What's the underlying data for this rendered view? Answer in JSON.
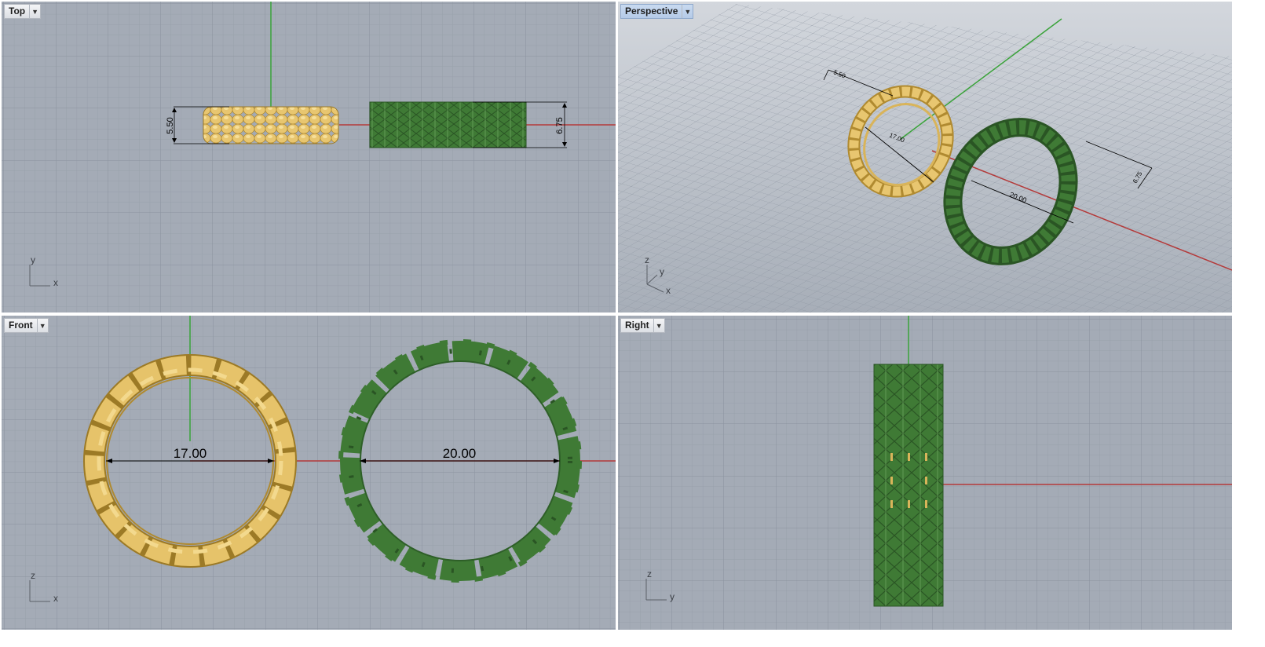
{
  "viewports": {
    "top": {
      "title": "Top",
      "axis_h": "x",
      "axis_v": "y",
      "dims": {
        "gold_height": "5.50",
        "green_height": "6.75"
      }
    },
    "persp": {
      "title": "Perspective",
      "axis_x": "x",
      "axis_y": "y",
      "axis_z": "z",
      "dims": {
        "gold_height": "5.50",
        "gold_diameter": "17.00",
        "green_height": "6.75",
        "green_diameter": "20.00"
      }
    },
    "front": {
      "title": "Front",
      "axis_h": "x",
      "axis_v": "z",
      "dims": {
        "gold_diameter": "17.00",
        "green_diameter": "20.00"
      }
    },
    "right": {
      "title": "Right",
      "axis_h": "y",
      "axis_v": "z"
    }
  },
  "colors": {
    "viewport_bg": "#a4abb6",
    "grid_minor": "#98a0ab",
    "grid_major": "#8a929e",
    "x_axis": "#b43a3a",
    "y_axis": "#3aa33a",
    "gold_ring": "#e3c068",
    "green_ring": "#3f7a35",
    "active_tab": "#c9daf0"
  }
}
